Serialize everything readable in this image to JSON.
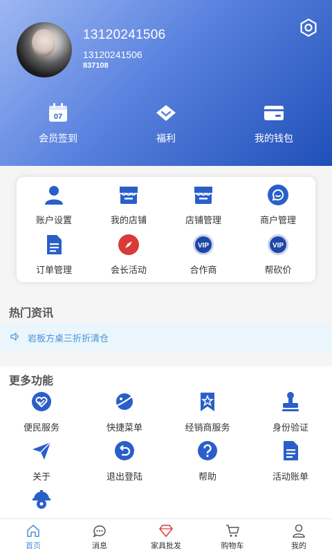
{
  "profile": {
    "name": "13120241506",
    "phone": "13120241506",
    "id": "837108"
  },
  "quick_actions": [
    {
      "label": "会员签到",
      "icon": "calendar-icon"
    },
    {
      "label": "福利",
      "icon": "gift-icon"
    },
    {
      "label": "我的钱包",
      "icon": "wallet-icon"
    }
  ],
  "grid": [
    {
      "label": "账户设置",
      "icon": "user-icon"
    },
    {
      "label": "我的店铺",
      "icon": "store-icon"
    },
    {
      "label": "店铺管理",
      "icon": "store-icon"
    },
    {
      "label": "商户管理",
      "icon": "chat-icon"
    },
    {
      "label": "订单管理",
      "icon": "document-icon"
    },
    {
      "label": "会长活动",
      "icon": "compass-icon"
    },
    {
      "label": "合作商",
      "icon": "vip-icon"
    },
    {
      "label": "帮砍价",
      "icon": "vip-icon"
    }
  ],
  "hot_news": {
    "title": "热门资讯",
    "item": "岩板方桌三折折清仓"
  },
  "more": {
    "title": "更多功能",
    "items": [
      {
        "label": "便民服务",
        "icon": "heart-icon"
      },
      {
        "label": "快捷菜单",
        "icon": "planet-icon"
      },
      {
        "label": "经销商服务",
        "icon": "bookmark-star-icon"
      },
      {
        "label": "身份验证",
        "icon": "stamp-icon"
      },
      {
        "label": "关于",
        "icon": "send-icon"
      },
      {
        "label": "退出登陆",
        "icon": "undo-icon"
      },
      {
        "label": "帮助",
        "icon": "question-icon"
      },
      {
        "label": "活动账单",
        "icon": "document-icon"
      },
      {
        "label": "",
        "icon": "gear-helmet-icon"
      }
    ]
  },
  "tabs": [
    {
      "label": "首页",
      "icon": "home-icon",
      "active": true
    },
    {
      "label": "消息",
      "icon": "message-icon"
    },
    {
      "label": "家具批发",
      "icon": "diamond-icon"
    },
    {
      "label": "购物车",
      "icon": "cart-icon"
    },
    {
      "label": "我的",
      "icon": "person-icon"
    }
  ],
  "colors": {
    "primary": "#2a5fc9",
    "accent_red": "#d93a3a",
    "news_text": "#4a8fd6"
  }
}
